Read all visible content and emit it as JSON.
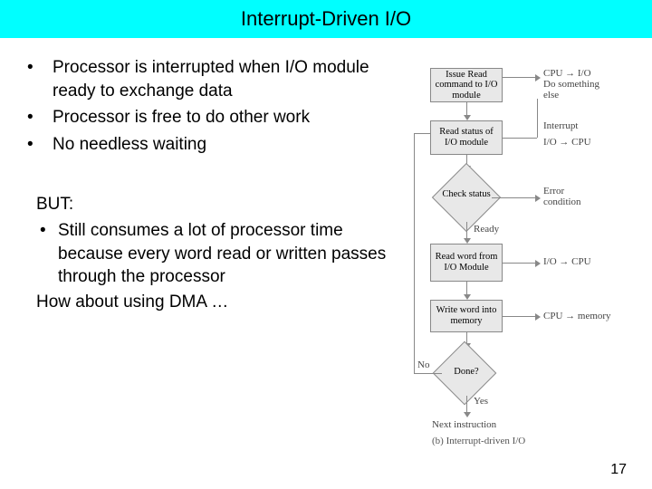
{
  "title": "Interrupt-Driven I/O",
  "bullets": [
    "Processor is interrupted when I/O module ready to exchange data",
    "Processor is free to do other work",
    "No needless waiting"
  ],
  "but_label": "BUT:",
  "but_point": "Still consumes a lot of processor time because every word read or written passes through the processor",
  "howabout": "How about  using DMA …",
  "page_number": "17",
  "diagram": {
    "box1": "Issue Read command to I/O module",
    "side1a": "CPU → I/O",
    "side1b": "Do something else",
    "box2": "Read status of I/O module",
    "side2a": "I/O → CPU",
    "side2b": "Interrupt",
    "diamond1": "Check status",
    "diamond1_right": "Error condition",
    "diamond1_down": "Ready",
    "box3": "Read word from I/O Module",
    "side3": "I/O → CPU",
    "box4": "Write word into memory",
    "side4": "CPU → memory",
    "diamond2": "Done?",
    "diamond2_left": "No",
    "diamond2_down": "Yes",
    "next": "Next instruction",
    "caption": "(b) Interrupt-driven I/O"
  }
}
